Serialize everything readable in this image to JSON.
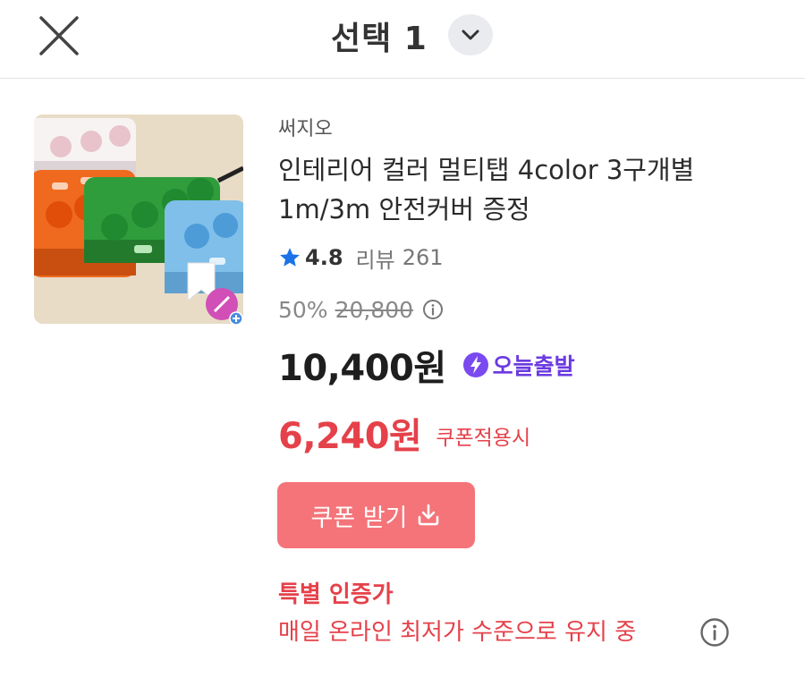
{
  "header": {
    "title": "선택 1"
  },
  "product": {
    "brand": "써지오",
    "title": "인테리어 컬러 멀티탭 4color 3구개별 1m/3m 안전커버 증정",
    "rating": "4.8",
    "reviews_label": "리뷰",
    "reviews_count": "261",
    "discount": "50%",
    "original_price": "20,800",
    "price": "10,400원",
    "delivery_badge": "오늘출발",
    "coupon_price": "6,240원",
    "coupon_note": "쿠폰적용시",
    "coupon_button_label": "쿠폰 받기"
  },
  "certification": {
    "title": "특별 인증가",
    "description": "매일 온라인 최저가 수준으로 유지 중"
  },
  "colors": {
    "accent_red": "#e5414a",
    "button_red": "#f47479",
    "badge_purple": "#6b3ae0",
    "star_blue": "#1a73e8"
  },
  "icons": [
    "close-icon",
    "chevron-down-icon",
    "star-icon",
    "info-icon",
    "lightning-icon",
    "download-icon",
    "bookmark-add-icon"
  ]
}
